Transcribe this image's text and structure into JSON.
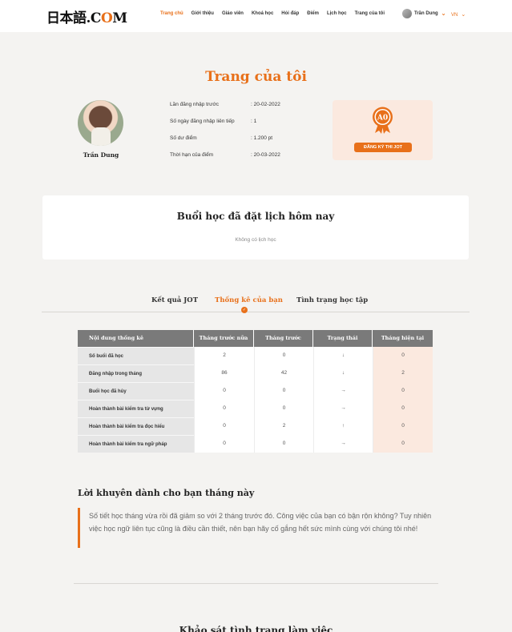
{
  "header": {
    "logo_main": "日本語.C",
    "logo_o": "O",
    "logo_end": "M",
    "nav": [
      "Trang chủ",
      "Giới thiệu",
      "Giáo viên",
      "Khoá học",
      "Hỏi đáp",
      "Điểm",
      "Lịch học",
      "Trang của tôi"
    ],
    "active_nav": "Trang chủ",
    "user_name": "Trần Dung",
    "language": "VN"
  },
  "page_title": "Trang của tôi",
  "profile": {
    "name": "Trần Dung",
    "info": [
      {
        "label": "Lần đăng nhập trước",
        "value": ": 20-02-2022"
      },
      {
        "label": "Số ngày đăng nhập liên tiếp",
        "value": ": 1"
      },
      {
        "label": "Số dư điểm",
        "value": ": 1.200 pt"
      },
      {
        "label": "Thời hạn của điểm",
        "value": ": 20-03-2022"
      }
    ]
  },
  "jot_card": {
    "badge": "A0",
    "button_label": "ĐĂNG KÝ THI JOT"
  },
  "schedule": {
    "title": "Buổi học đã đặt lịch hôm nay",
    "empty_text": "Không có lịch học"
  },
  "tabs": [
    "Kết quả JOT",
    "Thống kê của bạn",
    "Tình trạng học tập"
  ],
  "active_tab": 1,
  "stats": {
    "headers": [
      "Nội dung thống kê",
      "Tháng trước nữa",
      "Tháng trước",
      "Trạng thái",
      "Tháng hiện tại"
    ],
    "rows": [
      {
        "label": "Số buổi đã học",
        "prev2": "2",
        "prev": "0",
        "status": "down",
        "status_icon": "↓",
        "current": "0"
      },
      {
        "label": "Đăng nhập trong tháng",
        "prev2": "86",
        "prev": "42",
        "status": "down",
        "status_icon": "↓",
        "current": "2"
      },
      {
        "label": "Buổi học đã hủy",
        "prev2": "0",
        "prev": "0",
        "status": "right",
        "status_icon": "→",
        "current": "0"
      },
      {
        "label": "Hoàn thành bài kiểm tra từ vựng",
        "prev2": "0",
        "prev": "0",
        "status": "right",
        "status_icon": "→",
        "current": "0"
      },
      {
        "label": "Hoàn thành bài kiểm tra đọc hiểu",
        "prev2": "0",
        "prev": "2",
        "status": "up",
        "status_icon": "↑",
        "current": "0"
      },
      {
        "label": "Hoàn thành bài kiểm tra ngữ pháp",
        "prev2": "0",
        "prev": "0",
        "status": "right",
        "status_icon": "→",
        "current": "0"
      }
    ]
  },
  "advice": {
    "title": "Lời khuyên dành cho bạn tháng này",
    "text": "Số tiết học tháng vừa rồi đã giảm so với 2 tháng trước đó. Công việc của bạn có bận rộn không? Tuy nhiên việc học ngữ liên tục cũng là điều cần thiết, nên bạn hãy cố gắng hết sức mình cùng với chúng tôi nhé!"
  },
  "bottom_title": "Khảo sát tình trạng làm việc",
  "colors": {
    "accent": "#e8701a",
    "card_bg": "#fbe9df",
    "down": "#e23b2e",
    "up": "#27b34a"
  }
}
